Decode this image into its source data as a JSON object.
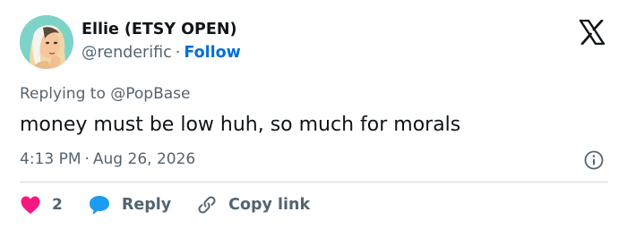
{
  "author": {
    "display_name": "Ellie (ETSY OPEN)",
    "handle": "@renderific",
    "separator": "·",
    "follow_label": "Follow"
  },
  "platform_icon": "x-logo-icon",
  "reply_context": "Replying to @PopBase",
  "tweet": {
    "text": "money must be low huh, so much for morals",
    "time": "4:13 PM",
    "separator": "·",
    "date": "Aug 26, 2026"
  },
  "actions": {
    "like_icon": "heart-icon",
    "like_count": "2",
    "reply_icon": "speech-bubble-icon",
    "reply_label": "Reply",
    "copy_icon": "link-icon",
    "copy_label": "Copy link"
  },
  "colors": {
    "text_primary": "#0f1419",
    "text_secondary": "#536471",
    "link_blue": "#006fd6",
    "like_pink": "#f91880",
    "reply_blue": "#1d9bf0",
    "divider": "#cfd9de"
  }
}
